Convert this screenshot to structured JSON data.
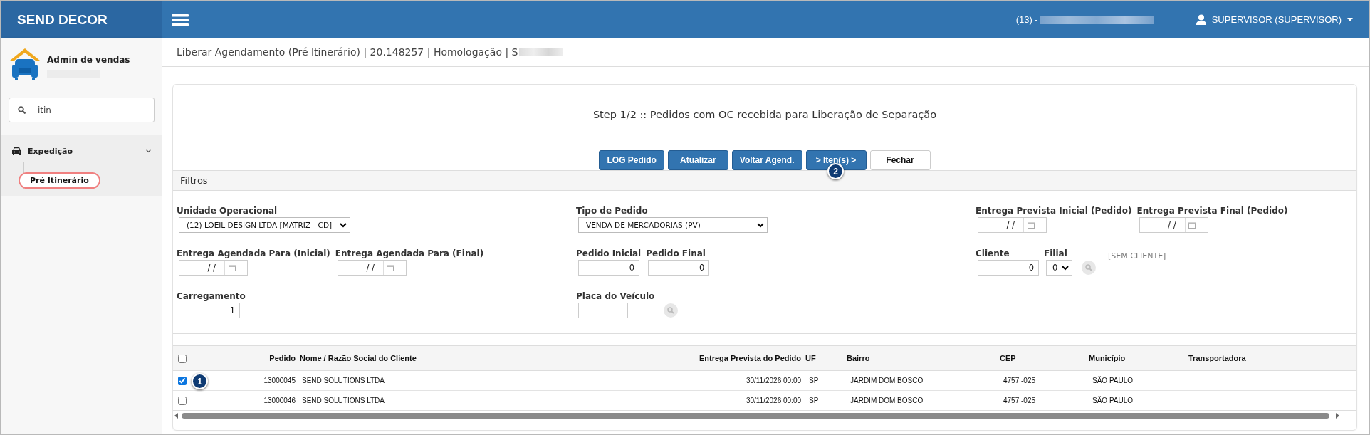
{
  "header": {
    "brand": "SEND DECOR",
    "phone": "(13) -",
    "user": "SUPERVISOR (SUPERVISOR)"
  },
  "sidebar": {
    "profile": "Admin de vendas",
    "search": {
      "value": "itin"
    },
    "menu": [
      {
        "label": "Expedição",
        "expanded": true,
        "children": [
          {
            "label": "Pré Itinerário",
            "selected": true
          }
        ]
      }
    ]
  },
  "breadcrumb": "Liberar Agendamento (Pré Itinerário) | 20.148257 | Homologação | S",
  "step_title": "Step 1/2 :: Pedidos com OC recebida para Liberação de Separação",
  "buttons": [
    {
      "label": "LOG Pedido",
      "kind": "primary"
    },
    {
      "label": "Atualizar",
      "kind": "primary"
    },
    {
      "label": "Voltar Agend.",
      "kind": "primary"
    },
    {
      "label": "> Iten(s) >",
      "kind": "primary",
      "badge": "2"
    },
    {
      "label": "Fechar",
      "kind": "default"
    }
  ],
  "filters": {
    "title": "Filtros",
    "columns": [
      [
        [
          {
            "label": "Unidade Operacional",
            "kind": "select",
            "value": "(12) LOEIL DESIGN LTDA [MATRIZ - CD]"
          }
        ],
        [
          {
            "label": "Entrega Agendada Para (Inicial)",
            "kind": "date",
            "value": "/  /"
          },
          {
            "label": "Entrega Agendada Para (Final)",
            "kind": "date",
            "value": "/  /"
          }
        ],
        [
          {
            "label": "Carregamento",
            "kind": "number",
            "value": "1"
          }
        ]
      ],
      [
        [
          {
            "label": "Tipo de Pedido",
            "kind": "select",
            "value": "VENDA DE MERCADORIAS (PV)"
          }
        ],
        [
          {
            "label": "Pedido Inicial",
            "kind": "number",
            "value": "0"
          },
          {
            "label": "Pedido Final",
            "kind": "number",
            "value": "0"
          }
        ],
        [
          {
            "label": "Placa do Veículo",
            "kind": "text"
          },
          {
            "kind": "search"
          }
        ]
      ],
      [
        [
          {
            "label": "Entrega Prevista Inicial (Pedido)",
            "kind": "date",
            "value": "/  /"
          },
          {
            "label": "Entrega Prevista Final (Pedido)",
            "kind": "date",
            "value": "/  /"
          }
        ],
        [
          {
            "label": "Cliente",
            "kind": "number",
            "value": "0"
          },
          {
            "label": "Filial",
            "kind": "small-select",
            "value": "0"
          },
          {
            "kind": "search"
          },
          {
            "kind": "note",
            "value": "[SEM CLIENTE]"
          }
        ]
      ]
    ]
  },
  "table": {
    "select_all": {
      "checked": false
    },
    "columns": [
      "Pedido",
      "Nome / Razão Social do Cliente",
      "Entrega Prevista do Pedido",
      "UF",
      "Bairro",
      "CEP",
      "Município",
      "Transportadora"
    ],
    "rows": [
      {
        "checked": true,
        "badge": "1",
        "cells": [
          "13000045",
          "SEND SOLUTIONS LTDA",
          "30/11/2026 00:00",
          "SP",
          "JARDIM DOM BOSCO",
          "4757 -025",
          "SÃO PAULO"
        ]
      },
      {
        "checked": false,
        "cells": [
          "13000046",
          "SEND SOLUTIONS LTDA",
          "30/11/2026 00:00",
          "SP",
          "JARDIM DOM BOSCO",
          "4757 -025",
          "SÃO PAULO"
        ]
      }
    ]
  }
}
